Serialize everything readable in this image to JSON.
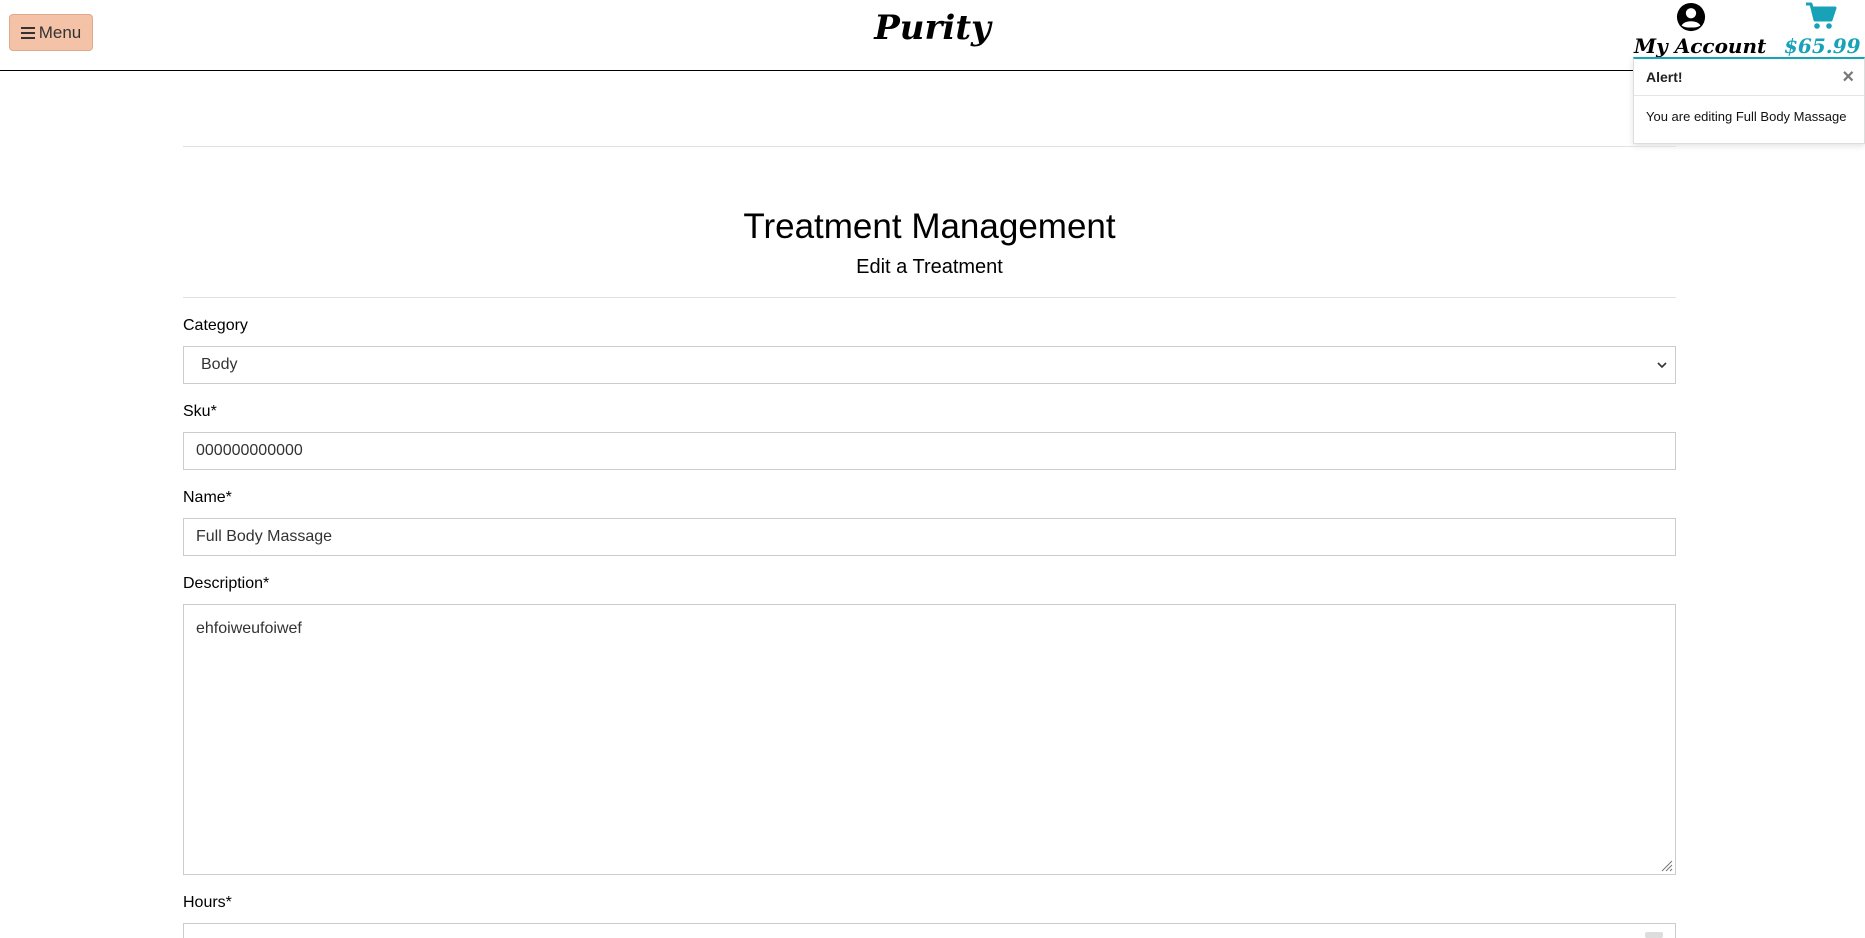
{
  "header": {
    "menu_label": "Menu",
    "brand": "Purity",
    "account_label": "My Account",
    "cart_total": "$65.99"
  },
  "alert": {
    "title": "Alert!",
    "close": "×",
    "message": "You are editing Full Body Massage"
  },
  "page": {
    "title": "Treatment Management",
    "subtitle": "Edit a Treatment"
  },
  "form": {
    "category_label": "Category",
    "category_value": "Body",
    "sku_label": "Sku*",
    "sku_value": "000000000000",
    "name_label": "Name*",
    "name_value": "Full Body Massage",
    "description_label": "Description*",
    "description_value": "ehfoiweufoiwef",
    "hours_label": "Hours*"
  },
  "colors": {
    "menu_button": "#f4c2a7",
    "accent": "#17a2b8"
  }
}
